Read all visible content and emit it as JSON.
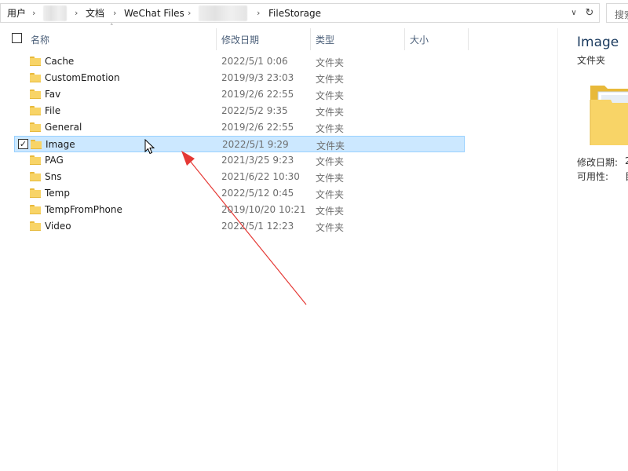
{
  "address_bar": {
    "segments": [
      "用户",
      "文档",
      "WeChat Files",
      "FileStorage"
    ],
    "dropdown_icon": "chevron-down-icon",
    "refresh_icon": "refresh-icon"
  },
  "search": {
    "placeholder": "搜索"
  },
  "columns": {
    "name": "名称",
    "modified": "修改日期",
    "type": "类型",
    "size": "大小"
  },
  "rows": [
    {
      "name": "Cache",
      "modified": "2022/5/1 0:06",
      "type": "文件夹"
    },
    {
      "name": "CustomEmotion",
      "modified": "2019/9/3 23:03",
      "type": "文件夹"
    },
    {
      "name": "Fav",
      "modified": "2019/2/6 22:55",
      "type": "文件夹"
    },
    {
      "name": "File",
      "modified": "2022/5/2 9:35",
      "type": "文件夹"
    },
    {
      "name": "General",
      "modified": "2019/2/6 22:55",
      "type": "文件夹"
    },
    {
      "name": "Image",
      "modified": "2022/5/1 9:29",
      "type": "文件夹",
      "selected": true,
      "checked": true
    },
    {
      "name": "PAG",
      "modified": "2021/3/25 9:23",
      "type": "文件夹"
    },
    {
      "name": "Sns",
      "modified": "2021/6/22 10:30",
      "type": "文件夹"
    },
    {
      "name": "Temp",
      "modified": "2022/5/12 0:45",
      "type": "文件夹"
    },
    {
      "name": "TempFromPhone",
      "modified": "2019/10/20 10:21",
      "type": "文件夹"
    },
    {
      "name": "Video",
      "modified": "2022/5/1 12:23",
      "type": "文件夹"
    }
  ],
  "details_pane": {
    "title": "Image",
    "subtitle": "文件夹",
    "props": [
      {
        "label": "修改日期:",
        "value": "2"
      },
      {
        "label": "可用性:",
        "value": "目"
      }
    ]
  },
  "colors": {
    "selection_fill": "#cce8ff",
    "selection_border": "#99d1ff",
    "folder_yellow": "#f8d467",
    "annotation_arrow": "#e53935"
  }
}
